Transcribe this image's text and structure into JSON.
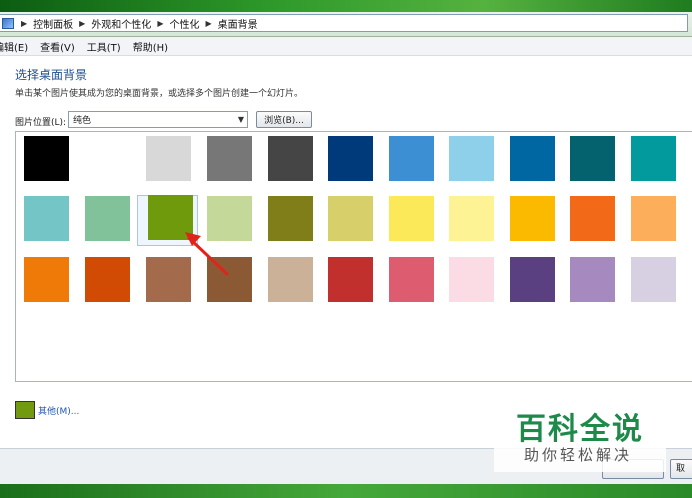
{
  "address_bar": {
    "breadcrumbs": [
      "控制面板",
      "外观和个性化",
      "个性化",
      "桌面背景"
    ]
  },
  "menu": {
    "items": [
      "编辑(E)",
      "查看(V)",
      "工具(T)",
      "帮助(H)"
    ]
  },
  "page": {
    "title": "选择桌面背景",
    "description": "单击某个图片使其成为您的桌面背景，或选择多个图片创建一个幻灯片。",
    "location_label": "图片位置(L):",
    "location_value": "纯色",
    "browse_label": "浏览(B)...",
    "other_label": "其他(M)...",
    "other_color": "#719a10"
  },
  "swatch_rows": [
    [
      "#000000",
      "#ffffff",
      "#d8d8d8",
      "#777777",
      "#454545",
      "#003a7a",
      "#3b8fd2",
      "#8ecfea",
      "#0067a3",
      "#04616e",
      "#039a9d"
    ],
    [
      "#74c6c6",
      "#81c29b",
      "#6e9a0c",
      "#c4d89a",
      "#7f7e18",
      "#d7cf69",
      "#fbe95a",
      "#fdf294",
      "#fbba00",
      "#f26a18",
      "#fdae5b"
    ],
    [
      "#f07a08",
      "#d24b04",
      "#a36a4b",
      "#8b5a35",
      "#cbb197",
      "#c2302d",
      "#de5c70",
      "#fbdce4",
      "#5a4081",
      "#a68abf",
      "#d7d0e2"
    ]
  ],
  "selected": {
    "row": 1,
    "col": 2
  },
  "footer": {
    "cancel_partial": "取"
  },
  "watermark": {
    "main": "百科全说",
    "sub": "助你轻松解决"
  }
}
